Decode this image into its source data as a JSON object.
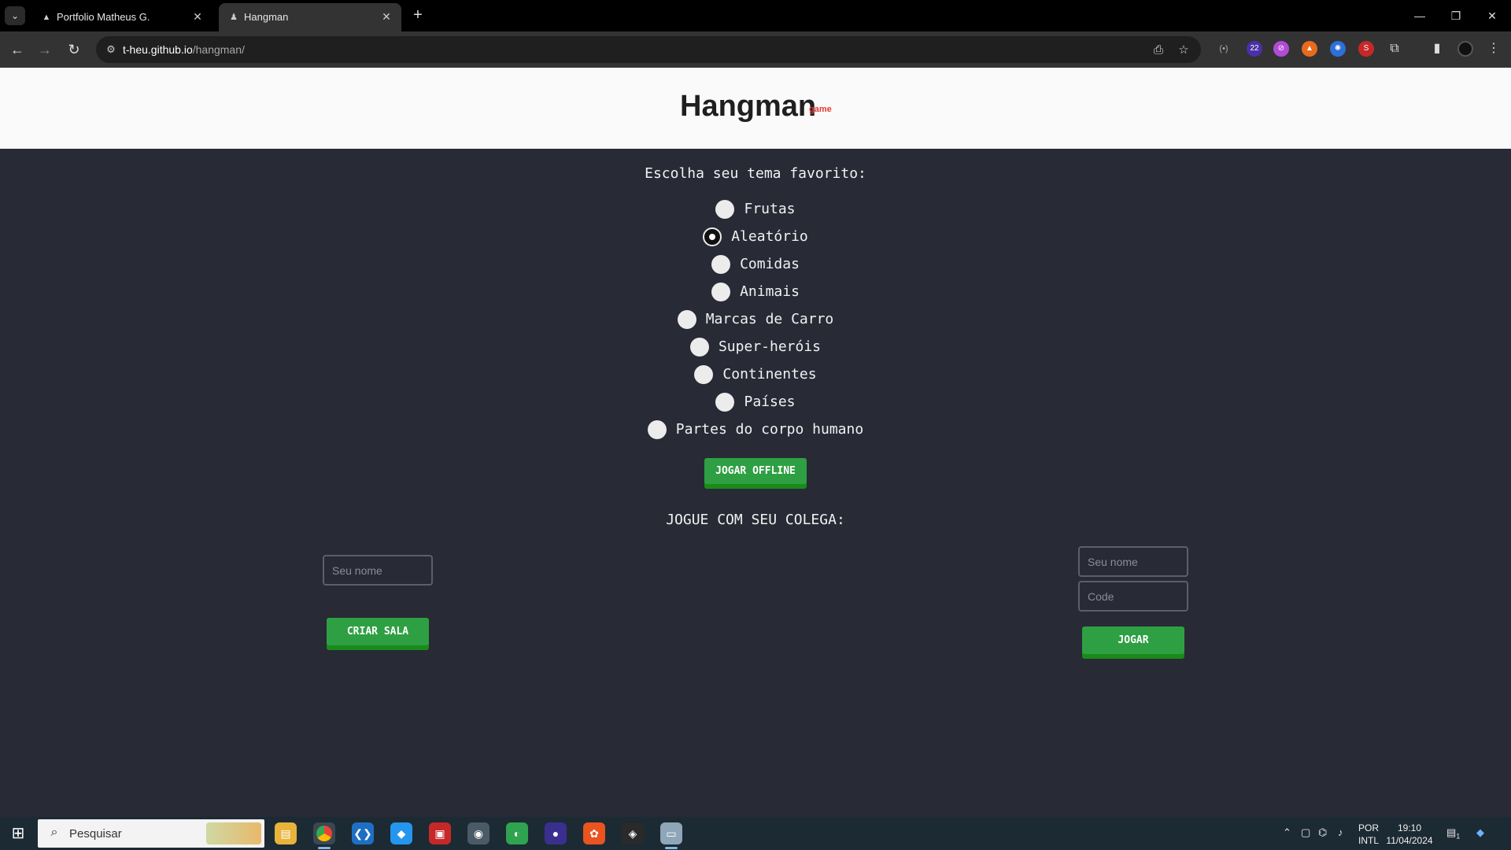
{
  "browser": {
    "tabs": [
      {
        "title": "Portfolio Matheus G.",
        "favicon": "triangle-icon"
      },
      {
        "title": "Hangman",
        "favicon": "game-icon"
      }
    ],
    "url_host": "t-heu.github.io",
    "url_path": "/hangman/"
  },
  "page": {
    "logo": "Hangman",
    "logo_sub": "game",
    "prompt": "Escolha seu tema favorito:",
    "themes": [
      {
        "label": "Frutas",
        "checked": false
      },
      {
        "label": "Aleatório",
        "checked": true
      },
      {
        "label": "Comidas",
        "checked": false
      },
      {
        "label": "Animais",
        "checked": false
      },
      {
        "label": "Marcas de Carro",
        "checked": false
      },
      {
        "label": "Super-heróis",
        "checked": false
      },
      {
        "label": "Continentes",
        "checked": false
      },
      {
        "label": "Países",
        "checked": false
      },
      {
        "label": "Partes do corpo humano",
        "checked": false
      }
    ],
    "offline_button": "JOGAR OFFLINE",
    "together_heading": "JOGUE COM SEU COLEGA:",
    "host": {
      "name_placeholder": "Seu nome",
      "create_button": "CRIAR SALA"
    },
    "join": {
      "name_placeholder": "Seu nome",
      "code_placeholder": "Code",
      "join_button": "JOGAR"
    }
  },
  "taskbar": {
    "search_placeholder": "Pesquisar",
    "lang_line1": "POR",
    "lang_line2": "INTL",
    "time": "19:10",
    "date": "11/04/2024",
    "notification_count": "1",
    "extension_badge": "22"
  },
  "colors": {
    "page_bg": "#282a36",
    "header_bg": "#fafafa",
    "button_green": "#2ea043",
    "accent_red": "#e53935"
  }
}
